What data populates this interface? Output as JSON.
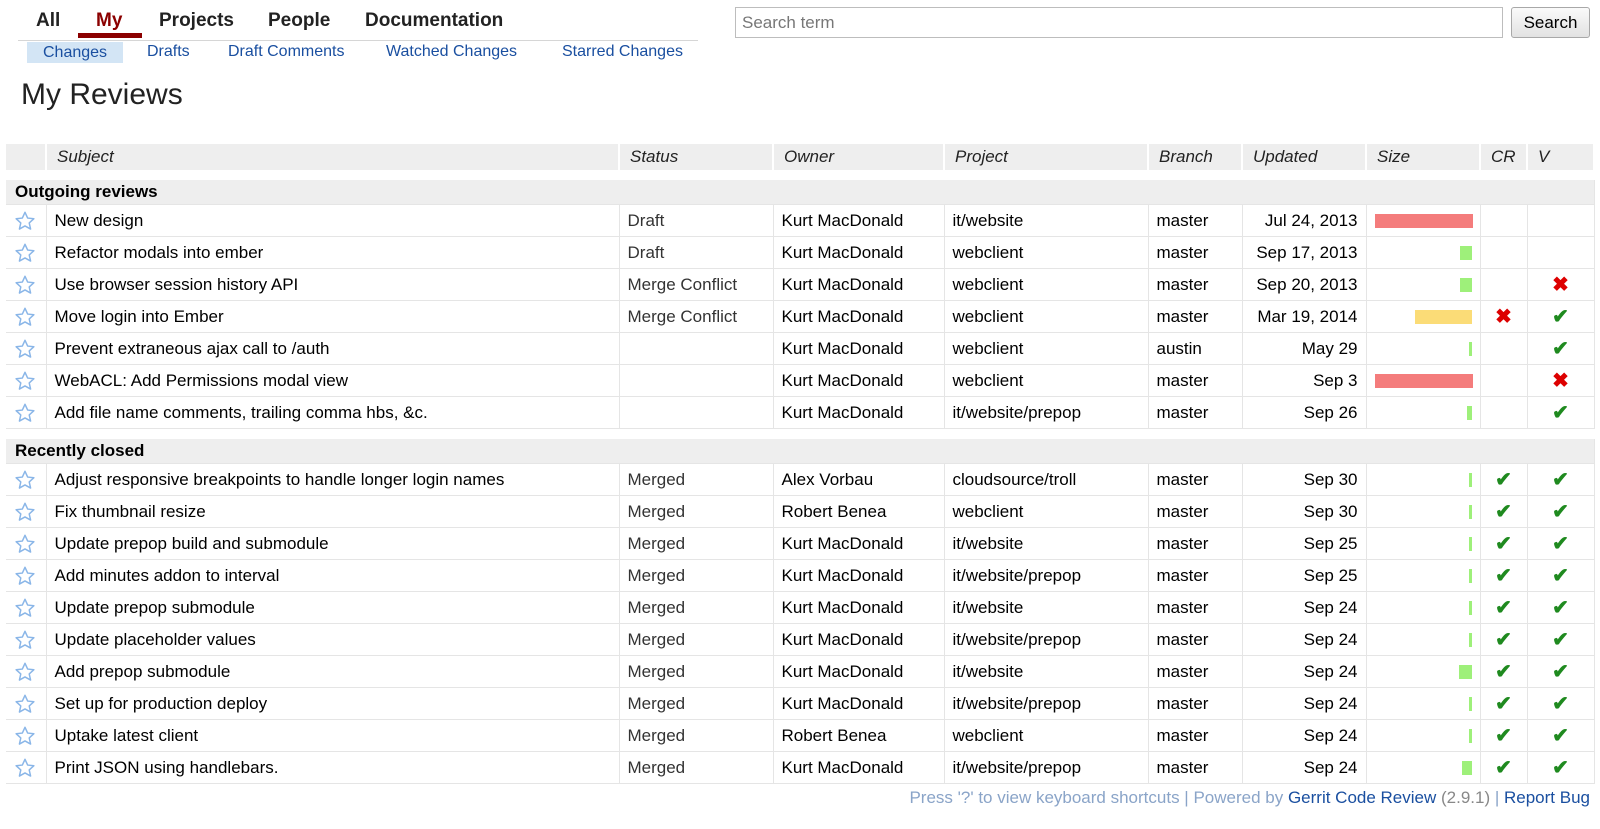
{
  "nav": {
    "tabs": [
      {
        "label": "All",
        "active": false
      },
      {
        "label": "My",
        "active": true
      },
      {
        "label": "Projects",
        "active": false
      },
      {
        "label": "People",
        "active": false
      },
      {
        "label": "Documentation",
        "active": false
      }
    ],
    "subtabs": [
      {
        "label": "Changes",
        "active": true
      },
      {
        "label": "Drafts",
        "active": false
      },
      {
        "label": "Draft Comments",
        "active": false
      },
      {
        "label": "Watched Changes",
        "active": false
      },
      {
        "label": "Starred Changes",
        "active": false
      }
    ]
  },
  "search": {
    "placeholder": "Search term",
    "value": "",
    "button_label": "Search"
  },
  "page_title": "My Reviews",
  "table": {
    "columns": [
      "Subject",
      "Status",
      "Owner",
      "Project",
      "Branch",
      "Updated",
      "Size",
      "CR",
      "V"
    ],
    "sections": [
      {
        "title": "Outgoing reviews",
        "rows": [
          {
            "subject": "New design",
            "status": "Draft",
            "owner": "Kurt MacDonald",
            "project": "it/website",
            "branch": "master",
            "updated": "Jul 24, 2013",
            "size": 1.0,
            "size_color": "#f47c7c",
            "cr": "",
            "v": ""
          },
          {
            "subject": "Refactor modals into ember",
            "status": "Draft",
            "owner": "Kurt MacDonald",
            "project": "webclient",
            "branch": "master",
            "updated": "Sep 17, 2013",
            "size": 0.12,
            "size_color": "#9ef07a",
            "cr": "",
            "v": ""
          },
          {
            "subject": "Use browser session history API",
            "status": "Merge Conflict",
            "owner": "Kurt MacDonald",
            "project": "webclient",
            "branch": "master",
            "updated": "Sep 20, 2013",
            "size": 0.12,
            "size_color": "#9ef07a",
            "cr": "",
            "v": "rejected"
          },
          {
            "subject": "Move login into Ember",
            "status": "Merge Conflict",
            "owner": "Kurt MacDonald",
            "project": "webclient",
            "branch": "master",
            "updated": "Mar 19, 2014",
            "size": 0.58,
            "size_color": "#fbdc77",
            "cr": "rejected",
            "v": "approved"
          },
          {
            "subject": "Prevent extraneous ajax call to /auth",
            "status": "",
            "owner": "Kurt MacDonald",
            "project": "webclient",
            "branch": "austin",
            "updated": "May 29",
            "size": 0.03,
            "size_color": "#9ef07a",
            "cr": "",
            "v": "approved"
          },
          {
            "subject": "WebACL: Add Permissions modal view",
            "status": "",
            "owner": "Kurt MacDonald",
            "project": "webclient",
            "branch": "master",
            "updated": "Sep 3",
            "size": 1.0,
            "size_color": "#f47c7c",
            "cr": "",
            "v": "rejected"
          },
          {
            "subject": "Add file name comments, trailing comma hbs, &c.",
            "status": "",
            "owner": "Kurt MacDonald",
            "project": "it/website/prepop",
            "branch": "master",
            "updated": "Sep 26",
            "size": 0.05,
            "size_color": "#9ef07a",
            "cr": "",
            "v": "approved"
          }
        ]
      },
      {
        "title": "Recently closed",
        "rows": [
          {
            "subject": "Adjust responsive breakpoints to handle longer login names",
            "status": "Merged",
            "owner": "Alex Vorbau",
            "project": "cloudsource/troll",
            "branch": "master",
            "updated": "Sep 30",
            "size": 0.03,
            "size_color": "#9ef07a",
            "cr": "approved",
            "v": "approved"
          },
          {
            "subject": "Fix thumbnail resize",
            "status": "Merged",
            "owner": "Robert Benea",
            "project": "webclient",
            "branch": "master",
            "updated": "Sep 30",
            "size": 0.03,
            "size_color": "#9ef07a",
            "cr": "approved",
            "v": "approved"
          },
          {
            "subject": "Update prepop build and submodule",
            "status": "Merged",
            "owner": "Kurt MacDonald",
            "project": "it/website",
            "branch": "master",
            "updated": "Sep 25",
            "size": 0.03,
            "size_color": "#9ef07a",
            "cr": "approved",
            "v": "approved"
          },
          {
            "subject": "Add minutes addon to interval",
            "status": "Merged",
            "owner": "Kurt MacDonald",
            "project": "it/website/prepop",
            "branch": "master",
            "updated": "Sep 25",
            "size": 0.03,
            "size_color": "#9ef07a",
            "cr": "approved",
            "v": "approved"
          },
          {
            "subject": "Update prepop submodule",
            "status": "Merged",
            "owner": "Kurt MacDonald",
            "project": "it/website",
            "branch": "master",
            "updated": "Sep 24",
            "size": 0.03,
            "size_color": "#9ef07a",
            "cr": "approved",
            "v": "approved"
          },
          {
            "subject": "Update placeholder values",
            "status": "Merged",
            "owner": "Kurt MacDonald",
            "project": "it/website/prepop",
            "branch": "master",
            "updated": "Sep 24",
            "size": 0.03,
            "size_color": "#9ef07a",
            "cr": "approved",
            "v": "approved"
          },
          {
            "subject": "Add prepop submodule",
            "status": "Merged",
            "owner": "Kurt MacDonald",
            "project": "it/website",
            "branch": "master",
            "updated": "Sep 24",
            "size": 0.13,
            "size_color": "#9ef07a",
            "cr": "approved",
            "v": "approved"
          },
          {
            "subject": "Set up for production deploy",
            "status": "Merged",
            "owner": "Kurt MacDonald",
            "project": "it/website/prepop",
            "branch": "master",
            "updated": "Sep 24",
            "size": 0.03,
            "size_color": "#9ef07a",
            "cr": "approved",
            "v": "approved"
          },
          {
            "subject": "Uptake latest client",
            "status": "Merged",
            "owner": "Robert Benea",
            "project": "webclient",
            "branch": "master",
            "updated": "Sep 24",
            "size": 0.03,
            "size_color": "#9ef07a",
            "cr": "approved",
            "v": "approved"
          },
          {
            "subject": "Print JSON using handlebars.",
            "status": "Merged",
            "owner": "Kurt MacDonald",
            "project": "it/website/prepop",
            "branch": "master",
            "updated": "Sep 24",
            "size": 0.1,
            "size_color": "#9ef07a",
            "cr": "approved",
            "v": "approved"
          }
        ]
      }
    ]
  },
  "icons": {
    "star": "star-outline-icon",
    "approved": "check-icon",
    "rejected": "cross-icon"
  },
  "colors": {
    "accent": "#8b0000",
    "link": "#1a4fa0",
    "approved": "#1f8a1f",
    "rejected": "#dd0000",
    "star": "#8ab6e8"
  },
  "footer": {
    "prefix": "Press '?' to view keyboard shortcuts | Powered by ",
    "gerrit_link": "Gerrit Code Review",
    "version": " (2.9.1)",
    "separator": " | ",
    "report_link": "Report Bug"
  }
}
